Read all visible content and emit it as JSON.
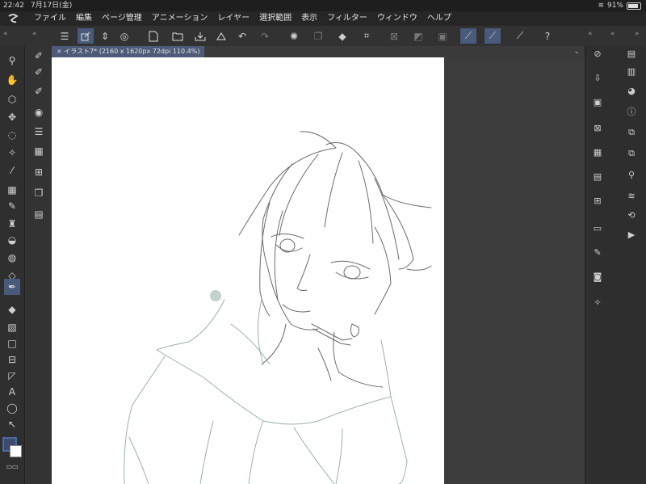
{
  "status": {
    "time": "22:42",
    "date": "7月17日(金)",
    "battery": "91%"
  },
  "menus": [
    "ファイル",
    "編集",
    "ページ管理",
    "アニメーション",
    "レイヤー",
    "選択範囲",
    "表示",
    "フィルター",
    "ウィンドウ",
    "ヘルプ"
  ],
  "tab": {
    "title": "イラスト7* (2160 x 1620px 72dpi 110.4%)",
    "close": "×"
  },
  "icons": {
    "collapse_left": "«",
    "collapse_right": "»",
    "menu": "☰",
    "undo": "↶",
    "redo": "↷",
    "help": "?",
    "dropdown": "⌄"
  },
  "colors": {
    "accent": "#4a5a7a",
    "main_color": "#3c4a6e",
    "sub_color": "#ffffff",
    "canvas": "#ffffff"
  }
}
